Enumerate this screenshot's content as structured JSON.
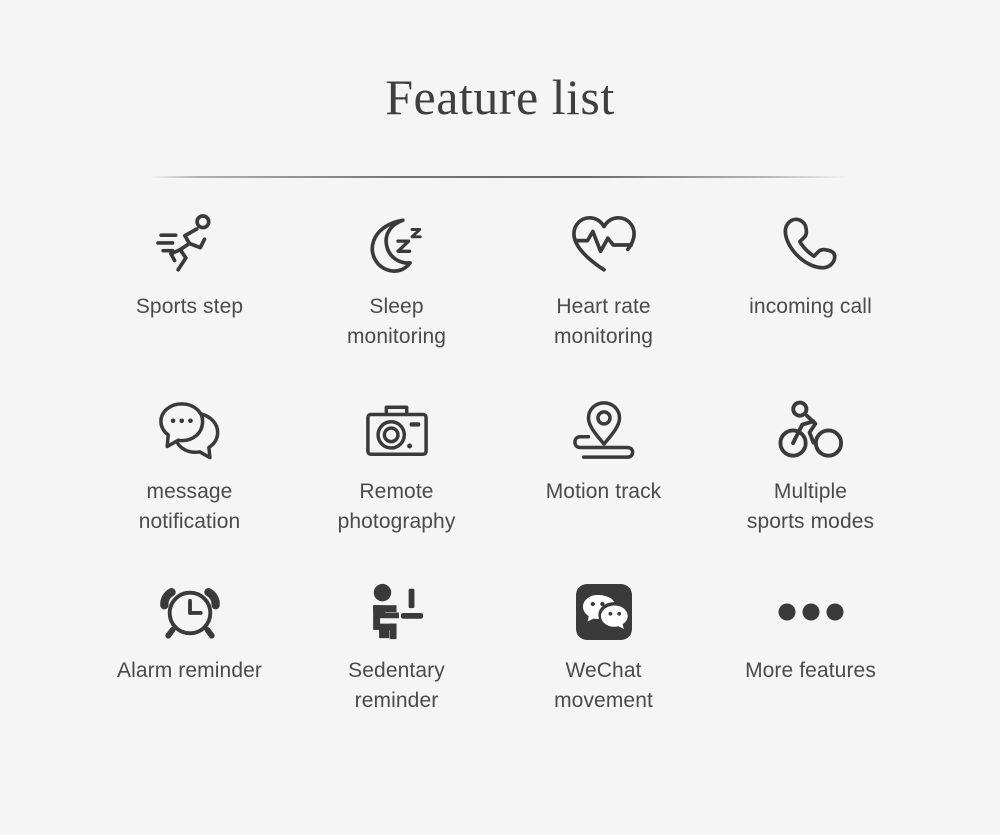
{
  "header": {
    "title": "Feature list"
  },
  "colors": {
    "background": "#f5f5f5",
    "title": "#3f3f3f",
    "icon_stroke": "#3a3a3a",
    "label": "#4a4a4a",
    "divider": "#5f5f5f"
  },
  "features": [
    {
      "icon": "running-person-icon",
      "label": "Sports step"
    },
    {
      "icon": "crescent-moon-zzz-icon",
      "label": "Sleep\nmonitoring"
    },
    {
      "icon": "heart-pulse-icon",
      "label": "Heart rate\nmonitoring"
    },
    {
      "icon": "phone-handset-icon",
      "label": "incoming call"
    },
    {
      "icon": "chat-bubbles-icon",
      "label": "message\nnotification"
    },
    {
      "icon": "camera-icon",
      "label": "Remote\nphotography"
    },
    {
      "icon": "map-pin-route-icon",
      "label": "Motion track"
    },
    {
      "icon": "bicycle-rider-icon",
      "label": "Multiple\nsports modes"
    },
    {
      "icon": "alarm-clock-icon",
      "label": "Alarm reminder"
    },
    {
      "icon": "seated-person-desk-icon",
      "label": "Sedentary\nreminder"
    },
    {
      "icon": "wechat-logo-icon",
      "label": "WeChat\nmovement"
    },
    {
      "icon": "ellipsis-dots-icon",
      "label": "More features"
    }
  ]
}
